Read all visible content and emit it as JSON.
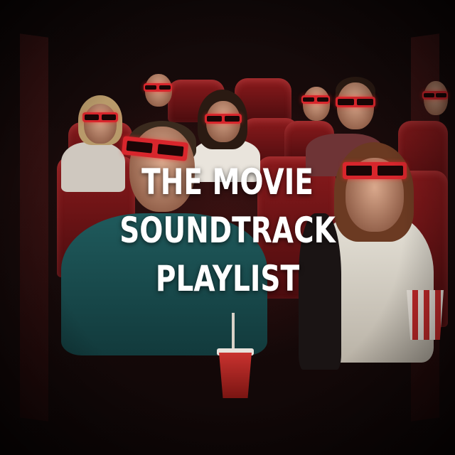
{
  "cover": {
    "title_lines": [
      "THE MOVIE",
      "SOUNDTRACK",
      "PLAYLIST"
    ]
  },
  "colors": {
    "glasses": "#d8262c",
    "seats": "#8a1a1c",
    "title": "#ffffff"
  },
  "scene": {
    "description_icons": [
      "3d-glasses-icon",
      "drink-cup-icon",
      "popcorn-icon"
    ]
  }
}
